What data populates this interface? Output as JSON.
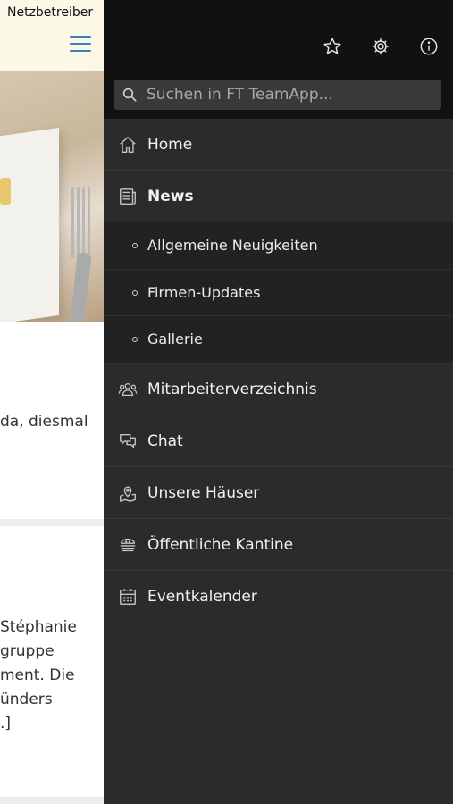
{
  "status_bar": {
    "carrier": "Netzbetreiber"
  },
  "background": {
    "lines": [
      "da, diesmal",
      "Stéphanie",
      "gruppe",
      "ment. Die",
      "ünders",
      ".]"
    ]
  },
  "drawer": {
    "top_icons": [
      "star-icon",
      "gear-icon",
      "info-icon"
    ],
    "search": {
      "placeholder": "Suchen in FT TeamApp..."
    },
    "items": [
      {
        "label": "Home",
        "icon": "home-icon"
      },
      {
        "label": "News",
        "icon": "newspaper-icon",
        "active": true
      },
      {
        "label": "Allgemeine Neuigkeiten",
        "sub": true
      },
      {
        "label": "Firmen-Updates",
        "sub": true
      },
      {
        "label": "Gallerie",
        "sub": true
      },
      {
        "label": "Mitarbeiterverzeichnis",
        "icon": "people-icon"
      },
      {
        "label": "Chat",
        "icon": "chat-icon"
      },
      {
        "label": "Unsere Häuser",
        "icon": "map-pin-icon"
      },
      {
        "label": "Öffentliche Kantine",
        "icon": "burger-icon"
      },
      {
        "label": "Eventkalender",
        "icon": "calendar-icon"
      }
    ]
  }
}
